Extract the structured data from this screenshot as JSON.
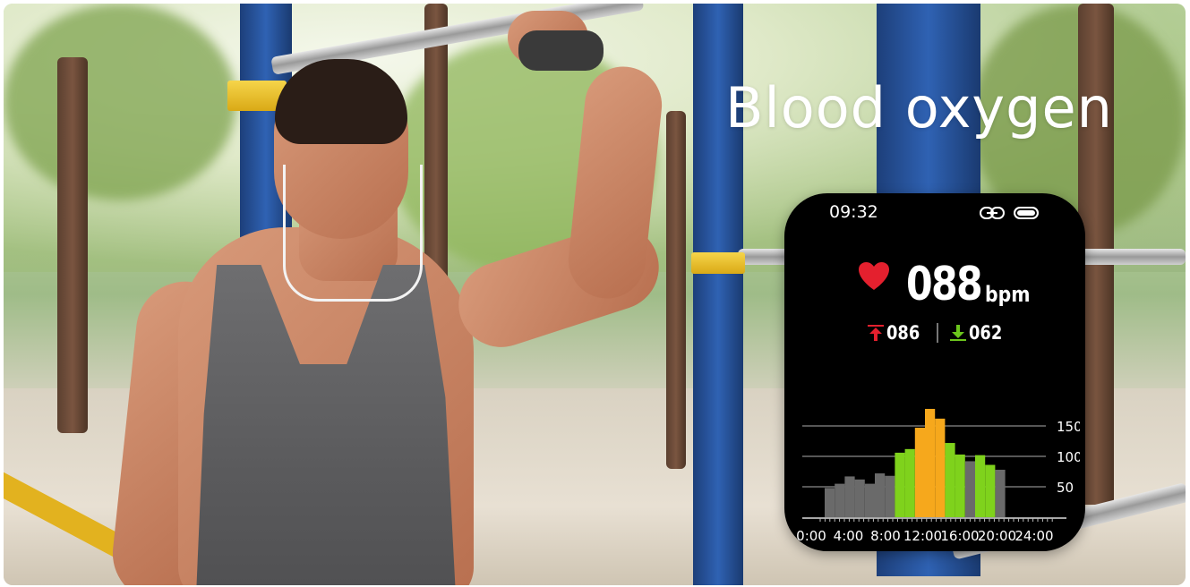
{
  "headline": "Blood oxygen",
  "watch": {
    "time": "09:32",
    "icons": [
      "link-icon",
      "battery-icon",
      "heart-icon",
      "arrow-up-icon",
      "arrow-down-icon"
    ],
    "heart_rate": "088",
    "unit": "bpm",
    "max": "086",
    "min": "062",
    "colors": {
      "heart": "#e4202e",
      "max_arrow": "#e4202e",
      "min_arrow": "#6cc61d",
      "bar_grey": "#6a6a6a",
      "bar_green": "#7fd21c",
      "bar_orange": "#f6a81c"
    }
  },
  "chart_data": {
    "type": "bar",
    "x_ticks": [
      "0:00",
      "4:00",
      "8:00",
      "12:00",
      "16:00",
      "20:00",
      "24:00"
    ],
    "y_ticks": [
      "150",
      "100",
      "50"
    ],
    "ylim": [
      0,
      150
    ],
    "grid": true,
    "bars": [
      {
        "hour": 0,
        "value": 48,
        "color": "grey"
      },
      {
        "hour": 1,
        "value": 55,
        "color": "grey"
      },
      {
        "hour": 2,
        "value": 67,
        "color": "grey"
      },
      {
        "hour": 3,
        "value": 62,
        "color": "grey"
      },
      {
        "hour": 4,
        "value": 55,
        "color": "grey"
      },
      {
        "hour": 5,
        "value": 72,
        "color": "grey"
      },
      {
        "hour": 6,
        "value": 68,
        "color": "grey"
      },
      {
        "hour": 7,
        "value": 106,
        "color": "green"
      },
      {
        "hour": 8,
        "value": 112,
        "color": "green"
      },
      {
        "hour": 9,
        "value": 147,
        "color": "orange"
      },
      {
        "hour": 10,
        "value": 178,
        "color": "orange"
      },
      {
        "hour": 11,
        "value": 162,
        "color": "orange"
      },
      {
        "hour": 12,
        "value": 122,
        "color": "green"
      },
      {
        "hour": 13,
        "value": 103,
        "color": "green"
      },
      {
        "hour": 14,
        "value": 92,
        "color": "grey"
      },
      {
        "hour": 15,
        "value": 102,
        "color": "green"
      },
      {
        "hour": 16,
        "value": 86,
        "color": "green"
      },
      {
        "hour": 17,
        "value": 78,
        "color": "grey"
      }
    ]
  }
}
